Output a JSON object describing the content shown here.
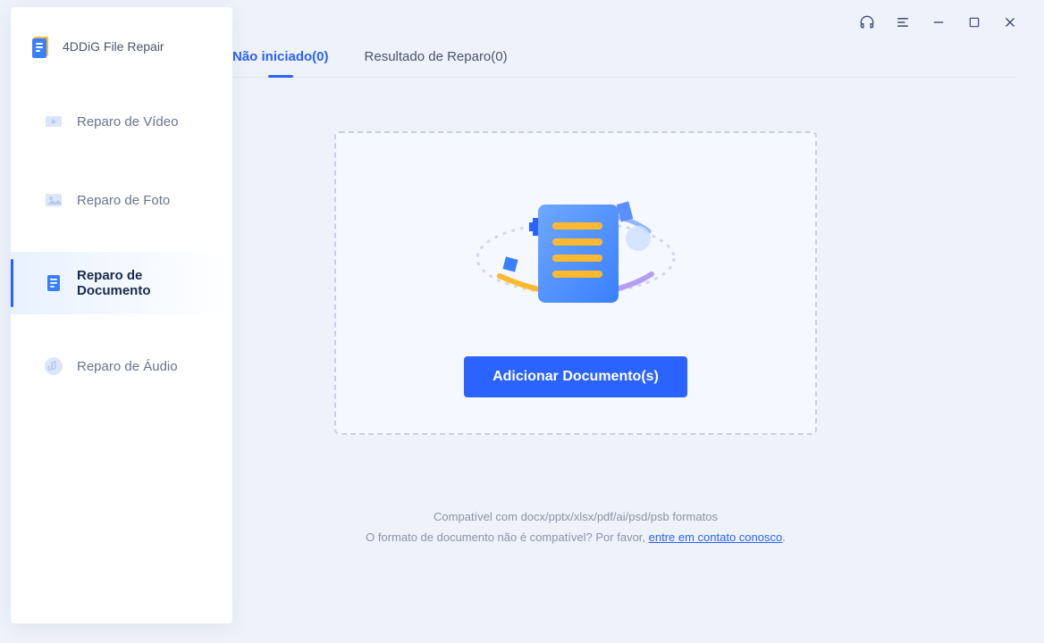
{
  "app": {
    "title": "4DDiG File Repair"
  },
  "sidebar": {
    "items": [
      {
        "label": "Reparo de Vídeo",
        "active": false
      },
      {
        "label": "Reparo de Foto",
        "active": false
      },
      {
        "label": "Reparo de Documento",
        "active": true
      },
      {
        "label": "Reparo de Áudio",
        "active": false
      }
    ]
  },
  "tabs": [
    {
      "label": "Não iniciado(0)",
      "active": true
    },
    {
      "label": "Resultado de Reparo(0)",
      "active": false
    }
  ],
  "dropzone": {
    "button_label": "Adicionar Documento(s)"
  },
  "footer": {
    "line1": "Compatível com docx/pptx/xlsx/pdf/ai/psd/psb formatos",
    "line2_prefix": "O formato de documento não é compatível? Por favor, ",
    "link_text": "entre em contato conosco",
    "line2_suffix": "."
  }
}
